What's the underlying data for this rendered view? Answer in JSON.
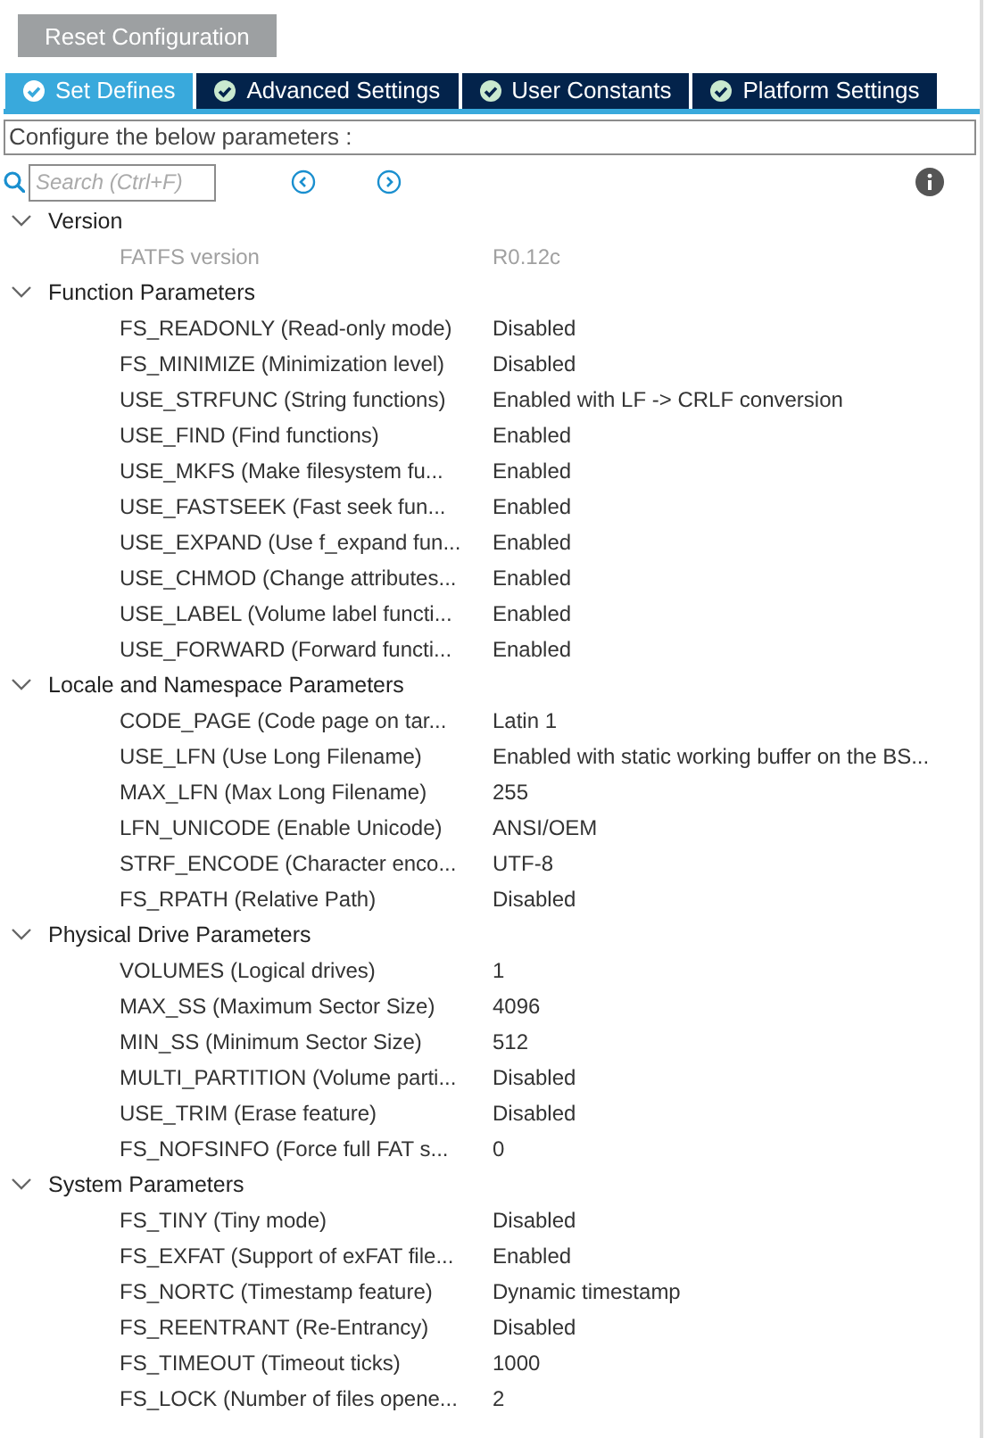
{
  "reset_button": "Reset Configuration",
  "tabs": [
    {
      "label": "Set Defines",
      "selected": true
    },
    {
      "label": "Advanced Settings",
      "selected": false
    },
    {
      "label": "User Constants",
      "selected": false
    },
    {
      "label": "Platform Settings",
      "selected": false
    }
  ],
  "description": "Configure the below parameters :",
  "search": {
    "placeholder": "Search (Ctrl+F)"
  },
  "groups": [
    {
      "title": "Version",
      "expanded": true,
      "rows": [
        {
          "name": "FATFS version",
          "value": "R0.12c",
          "disabled": true
        }
      ]
    },
    {
      "title": "Function Parameters",
      "expanded": true,
      "rows": [
        {
          "name": "FS_READONLY (Read-only mode)",
          "value": "Disabled",
          "disabled": false
        },
        {
          "name": "FS_MINIMIZE (Minimization level)",
          "value": "Disabled",
          "disabled": false
        },
        {
          "name": "USE_STRFUNC (String functions)",
          "value": "Enabled with LF -> CRLF conversion",
          "disabled": false
        },
        {
          "name": "USE_FIND (Find functions)",
          "value": "Enabled",
          "disabled": false
        },
        {
          "name": "USE_MKFS (Make filesystem fu...",
          "value": "Enabled",
          "disabled": false
        },
        {
          "name": "USE_FASTSEEK (Fast seek fun...",
          "value": "Enabled",
          "disabled": false
        },
        {
          "name": "USE_EXPAND (Use f_expand fun...",
          "value": "Enabled",
          "disabled": false
        },
        {
          "name": "USE_CHMOD (Change attributes...",
          "value": "Enabled",
          "disabled": false
        },
        {
          "name": "USE_LABEL (Volume label functi...",
          "value": "Enabled",
          "disabled": false
        },
        {
          "name": "USE_FORWARD (Forward functi...",
          "value": "Enabled",
          "disabled": false
        }
      ]
    },
    {
      "title": "Locale and Namespace Parameters",
      "expanded": true,
      "rows": [
        {
          "name": "CODE_PAGE (Code page on tar...",
          "value": "Latin 1",
          "disabled": false
        },
        {
          "name": "USE_LFN (Use Long Filename)",
          "value": "Enabled with static working buffer on the BS...",
          "disabled": false
        },
        {
          "name": "MAX_LFN (Max Long Filename)",
          "value": "255",
          "disabled": false
        },
        {
          "name": "LFN_UNICODE (Enable Unicode)",
          "value": "ANSI/OEM",
          "disabled": false
        },
        {
          "name": "STRF_ENCODE (Character enco...",
          "value": "UTF-8",
          "disabled": false
        },
        {
          "name": "FS_RPATH (Relative Path)",
          "value": "Disabled",
          "disabled": false
        }
      ]
    },
    {
      "title": "Physical Drive Parameters",
      "expanded": true,
      "rows": [
        {
          "name": "VOLUMES (Logical drives)",
          "value": "1",
          "disabled": false
        },
        {
          "name": "MAX_SS (Maximum Sector Size)",
          "value": "4096",
          "disabled": false
        },
        {
          "name": "MIN_SS (Minimum Sector Size)",
          "value": "512",
          "disabled": false
        },
        {
          "name": "MULTI_PARTITION (Volume parti...",
          "value": "Disabled",
          "disabled": false
        },
        {
          "name": "USE_TRIM (Erase feature)",
          "value": "Disabled",
          "disabled": false
        },
        {
          "name": "FS_NOFSINFO (Force full FAT s...",
          "value": "0",
          "disabled": false
        }
      ]
    },
    {
      "title": "System Parameters",
      "expanded": true,
      "rows": [
        {
          "name": "FS_TINY (Tiny mode)",
          "value": "Disabled",
          "disabled": false
        },
        {
          "name": "FS_EXFAT (Support of exFAT file...",
          "value": "Enabled",
          "disabled": false
        },
        {
          "name": "FS_NORTC (Timestamp feature)",
          "value": "Dynamic timestamp",
          "disabled": false
        },
        {
          "name": "FS_REENTRANT (Re-Entrancy)",
          "value": "Disabled",
          "disabled": false
        },
        {
          "name": "FS_TIMEOUT (Timeout ticks)",
          "value": "1000",
          "disabled": false
        },
        {
          "name": "FS_LOCK (Number of files opene...",
          "value": "2",
          "disabled": false
        }
      ]
    }
  ]
}
